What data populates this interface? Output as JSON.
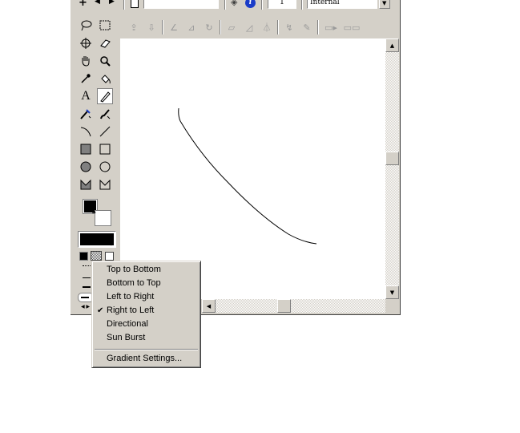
{
  "top_toolbar": {
    "frame_number": "1",
    "quality_select": "Internal",
    "blank_field": ""
  },
  "tools": [
    {
      "name": "lasso-tool",
      "icon": "lasso"
    },
    {
      "name": "marquee-tool",
      "icon": "marquee"
    },
    {
      "name": "crosshair-tool",
      "icon": "crosshair"
    },
    {
      "name": "eraser-tool",
      "icon": "eraser"
    },
    {
      "name": "hand-tool",
      "icon": "hand"
    },
    {
      "name": "zoom-tool",
      "icon": "magnifier"
    },
    {
      "name": "eyedropper-tool",
      "icon": "eyedropper"
    },
    {
      "name": "paint-bucket-tool",
      "icon": "paint-bucket"
    },
    {
      "name": "text-tool",
      "icon": "text",
      "glyph": "A"
    },
    {
      "name": "pencil-tool",
      "icon": "pencil",
      "active": true
    },
    {
      "name": "pen-tool",
      "icon": "pen"
    },
    {
      "name": "brush-tool",
      "icon": "brush"
    },
    {
      "name": "curve-tool",
      "icon": "curve"
    },
    {
      "name": "line-tool",
      "icon": "line"
    },
    {
      "name": "filled-rectangle-tool",
      "icon": "filled-rectangle"
    },
    {
      "name": "rectangle-tool",
      "icon": "rectangle"
    },
    {
      "name": "filled-ellipse-tool",
      "icon": "filled-ellipse"
    },
    {
      "name": "ellipse-tool",
      "icon": "ellipse"
    },
    {
      "name": "filled-envelope-tool",
      "icon": "filled-envelope"
    },
    {
      "name": "envelope-tool",
      "icon": "envelope"
    }
  ],
  "colors": {
    "foreground": "#000000",
    "background": "#ffffff",
    "fill_swatch": "#000000"
  },
  "gradient_menu": {
    "items": [
      {
        "label": "Top to Bottom",
        "checked": false
      },
      {
        "label": "Bottom to Top",
        "checked": false
      },
      {
        "label": "Left to Right",
        "checked": false
      },
      {
        "label": "Right to Left",
        "checked": true
      },
      {
        "label": "Directional",
        "checked": false
      },
      {
        "label": "Sun Burst",
        "checked": false
      }
    ],
    "settings_label": "Gradient Settings...",
    "check_glyph": "✔"
  },
  "canvas": {
    "background": "#ffffff",
    "stroke_color": "#000000"
  },
  "scrollbars": {
    "vertical_thumb": 0.5,
    "horizontal_thumb": 0.5
  }
}
